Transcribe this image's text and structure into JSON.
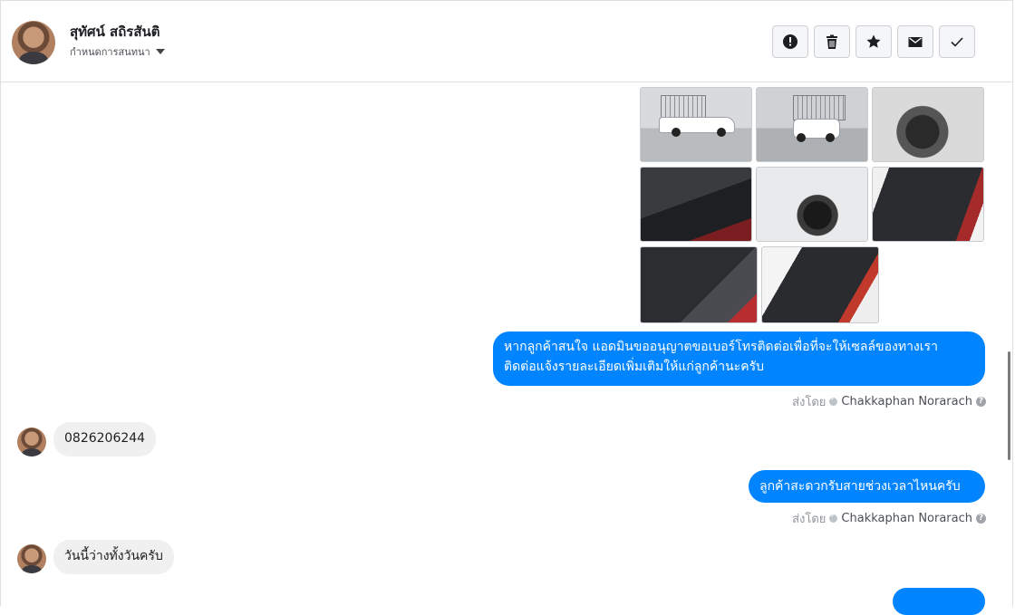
{
  "header": {
    "contact_name": "สุทัศน์ สถิรสันติ",
    "assign_label": "กำหนดการสนทนา"
  },
  "toolbar": {
    "buttons": [
      {
        "icon": "alert-icon"
      },
      {
        "icon": "trash-icon"
      },
      {
        "icon": "star-icon"
      },
      {
        "icon": "envelope-icon"
      },
      {
        "icon": "checkmark-icon"
      }
    ]
  },
  "conversation": {
    "messages": [
      {
        "direction": "out",
        "text_line1": "หากลูกค้าสนใจ แอดมินขออนุญาตขอเบอร์โทรติดต่อเพื่อที่จะให้เซลล์ของทางเรา",
        "text_line2": "ติดต่อแจ้งรายละเอียดเพิ่มเติมให้แก่ลูกค้านะครับ",
        "sent_by_label": "ส่งโดย",
        "sender": "Chakkaphan Norarach"
      },
      {
        "direction": "in",
        "text": "0826206244"
      },
      {
        "direction": "out",
        "text": "ลูกค้าสะดวกรับสายช่วงเวลาไหนครับ",
        "sent_by_label": "ส่งโดย",
        "sender": "Chakkaphan Norarach"
      },
      {
        "direction": "in",
        "text": "วันนี้ว่างทั้งวันครับ"
      }
    ],
    "photos": [
      "truck-side",
      "truck-front",
      "wheel",
      "dashboard",
      "front-side",
      "door",
      "gear-seat",
      "interior"
    ]
  },
  "colors": {
    "accent": "#0084ff",
    "incoming_bubble": "#f1f0f0",
    "border": "#dddfe2"
  }
}
